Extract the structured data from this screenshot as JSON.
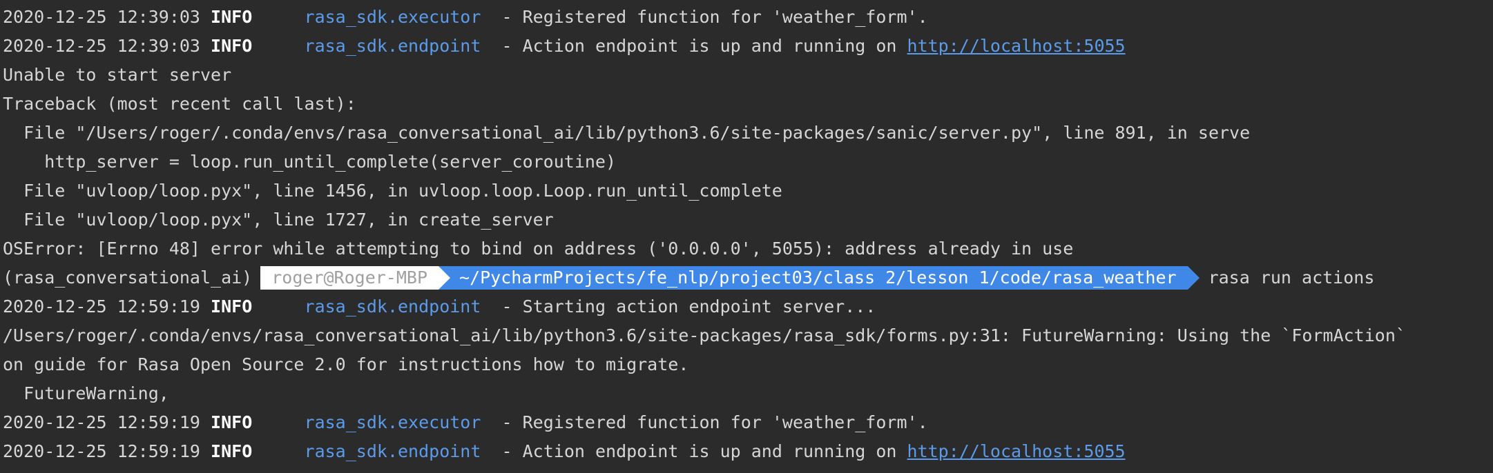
{
  "log": [
    {
      "ts": "2020-12-25 12:39:03",
      "level": "INFO",
      "module": "rasa_sdk.executor",
      "msg": "- Registered function for 'weather_form'."
    },
    {
      "ts": "2020-12-25 12:39:03",
      "level": "INFO",
      "module": "rasa_sdk.endpoint",
      "msg": "- Action endpoint is up and running on ",
      "link": "http://localhost:5055"
    }
  ],
  "error": {
    "l1": "Unable to start server",
    "l2": "Traceback (most recent call last):",
    "l3": "  File \"/Users/roger/.conda/envs/rasa_conversational_ai/lib/python3.6/site-packages/sanic/server.py\", line 891, in serve",
    "l4": "    http_server = loop.run_until_complete(server_coroutine)",
    "l5": "  File \"uvloop/loop.pyx\", line 1456, in uvloop.loop.Loop.run_until_complete",
    "l6": "  File \"uvloop/loop.pyx\", line 1727, in create_server",
    "l7": "OSError: [Errno 48] error while attempting to bind on address ('0.0.0.0', 5055): address already in use"
  },
  "prompt": {
    "env": "(rasa_conversational_ai)",
    "user": "roger@Roger-MBP",
    "path": "~/PycharmProjects/fe_nlp/project03/class 2/lesson 1/code/rasa_weather",
    "command": "rasa run actions"
  },
  "log2": [
    {
      "ts": "2020-12-25 12:59:19",
      "level": "INFO",
      "module": "rasa_sdk.endpoint",
      "msg": "- Starting action endpoint server..."
    }
  ],
  "warning": {
    "l1": "/Users/roger/.conda/envs/rasa_conversational_ai/lib/python3.6/site-packages/rasa_sdk/forms.py:31: FutureWarning: Using the `FormAction`",
    "l2": "on guide for Rasa Open Source 2.0 for instructions how to migrate.",
    "l3": "  FutureWarning,"
  },
  "log3": [
    {
      "ts": "2020-12-25 12:59:19",
      "level": "INFO",
      "module": "rasa_sdk.executor",
      "msg": "- Registered function for 'weather_form'."
    },
    {
      "ts": "2020-12-25 12:59:19",
      "level": "INFO",
      "module": "rasa_sdk.endpoint",
      "msg": "- Action endpoint is up and running on ",
      "link": "http://localhost:5055"
    }
  ],
  "colors": {
    "background": "#2b2b2b",
    "text": "#d6d6d6",
    "module": "#5c9be9",
    "prompt_path_bg": "#3f88e8",
    "prompt_user_bg": "#ffffff",
    "prompt_user_fg": "#a0a0a0"
  }
}
